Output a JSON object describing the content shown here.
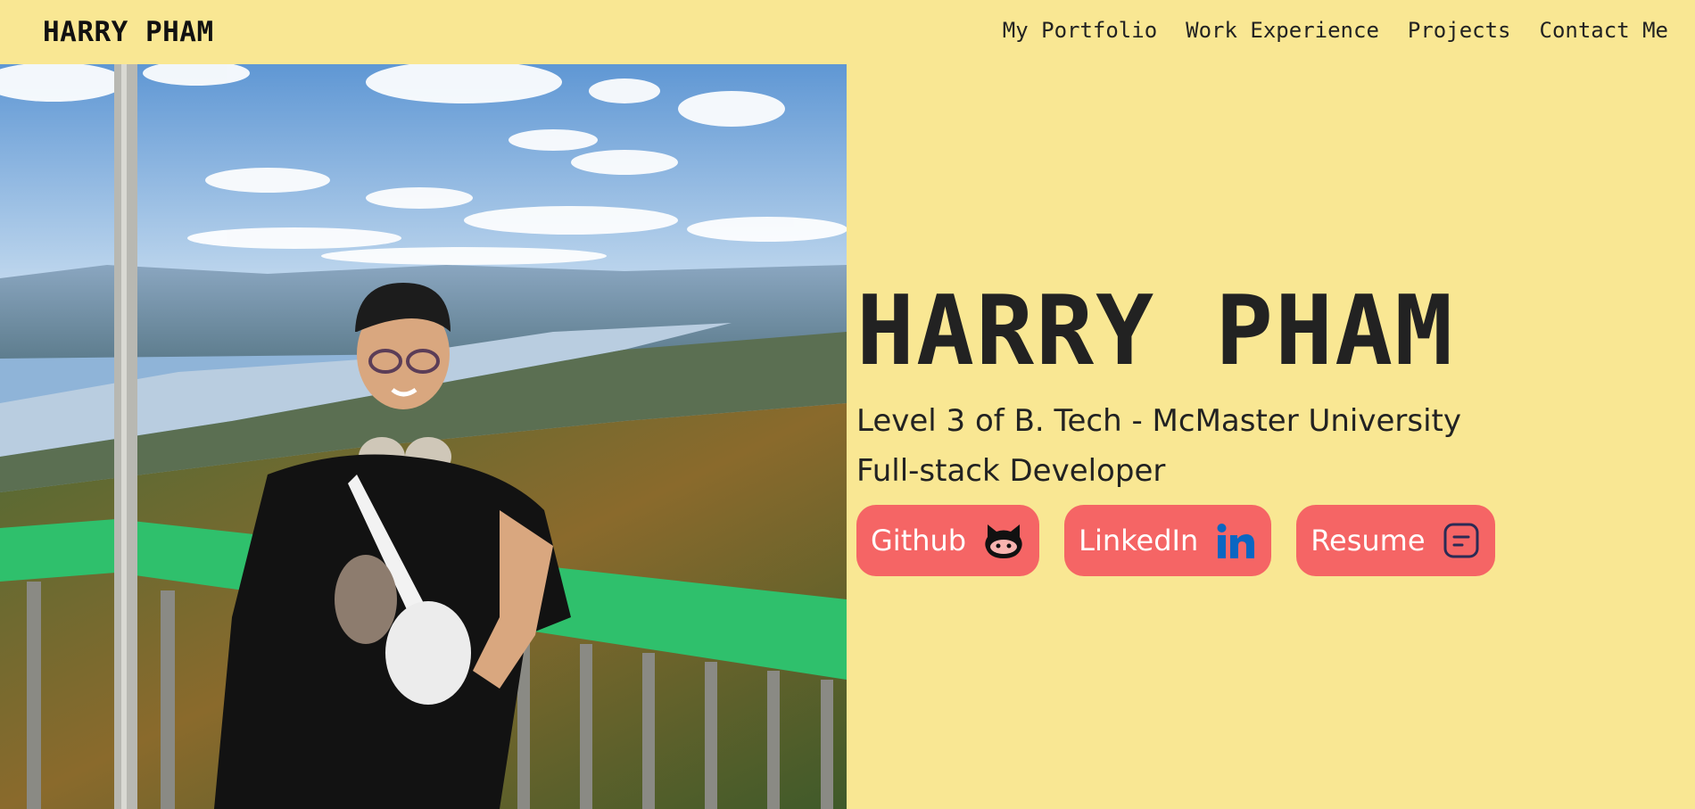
{
  "nav": {
    "brand": "HARRY PHAM",
    "links": [
      "My Portfolio",
      "Work Experience",
      "Projects",
      "Contact Me"
    ]
  },
  "hero": {
    "name": "HARRY PHAM",
    "line1": "Level 3 of B. Tech - McMaster University",
    "line2": "Full-stack Developer",
    "buttons": [
      {
        "label": "Github",
        "icon": "github-octocat-icon"
      },
      {
        "label": "LinkedIn",
        "icon": "linkedin-icon"
      },
      {
        "label": "Resume",
        "icon": "resume-document-icon"
      }
    ]
  },
  "colors": {
    "background": "#f9e793",
    "button": "#f56565",
    "linkedin_blue": "#0a66c2",
    "text": "#222222"
  }
}
